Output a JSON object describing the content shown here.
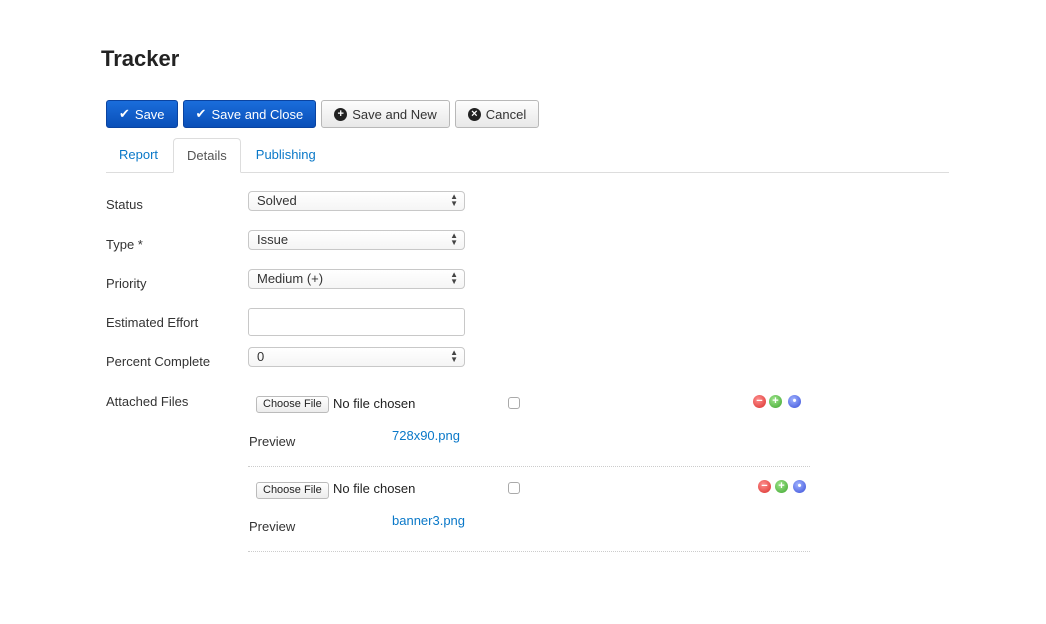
{
  "page": {
    "title": "Tracker"
  },
  "toolbar": {
    "save": {
      "label": "Save",
      "icon": "check-icon"
    },
    "save_close": {
      "label": "Save and Close",
      "icon": "check-icon"
    },
    "save_new": {
      "label": "Save and New",
      "icon": "plus-circle-icon"
    },
    "cancel": {
      "label": "Cancel",
      "icon": "x-circle-icon"
    }
  },
  "tabs": [
    {
      "label": "Report",
      "active": false
    },
    {
      "label": "Details",
      "active": true
    },
    {
      "label": "Publishing",
      "active": false
    }
  ],
  "form": {
    "status": {
      "label": "Status",
      "value": "Solved"
    },
    "type": {
      "label": "Type *",
      "value": "Issue"
    },
    "priority": {
      "label": "Priority",
      "value": "Medium (+)"
    },
    "estimated_effort": {
      "label": "Estimated Effort",
      "value": ""
    },
    "percent_complete": {
      "label": "Percent Complete",
      "value": "0"
    },
    "attached_files": {
      "label": "Attached Files",
      "files": [
        {
          "choose_label": "Choose File",
          "status": "No file chosen",
          "preview_label": "Preview",
          "filename": "728x90.png",
          "checked": false
        },
        {
          "choose_label": "Choose File",
          "status": "No file chosen",
          "preview_label": "Preview",
          "filename": "banner3.png",
          "checked": false
        }
      ]
    }
  },
  "colors": {
    "primary": "#0a5fcc",
    "link": "#0a78c8",
    "remove": "#d9302b",
    "add": "#3ea52e",
    "move": "#3a4fd8"
  }
}
